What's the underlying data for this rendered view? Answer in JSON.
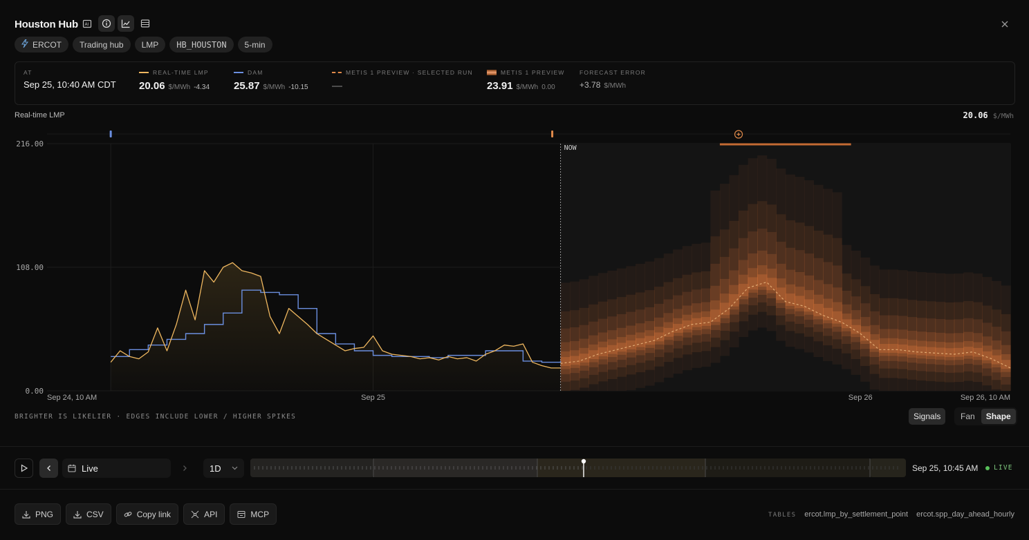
{
  "header": {
    "title": "Houston Hub",
    "icons": [
      "ai-icon",
      "info-icon",
      "chart-icon",
      "table-icon"
    ],
    "close_icon": "close-icon"
  },
  "tags": [
    {
      "label": "ERCOT",
      "icon": "bolt-icon"
    },
    {
      "label": "Trading hub"
    },
    {
      "label": "LMP"
    },
    {
      "label": "HB_HOUSTON"
    },
    {
      "label": "5-min"
    }
  ],
  "stats": {
    "at": {
      "label": "AT",
      "value": "Sep 25, 10:40 AM CDT"
    },
    "rt": {
      "label": "REAL-TIME LMP",
      "value": "20.06",
      "unit": "$/MWh",
      "delta": "-4.34",
      "color": "#f0b860"
    },
    "dam": {
      "label": "DAM",
      "value": "25.87",
      "unit": "$/MWh",
      "delta": "-10.15",
      "color": "#6b8fe0"
    },
    "preview_run": {
      "label": "METIS 1 PREVIEW · SELECTED RUN",
      "value": "—",
      "color": "#e08a4a"
    },
    "preview": {
      "label": "METIS 1 PREVIEW",
      "value": "23.91",
      "unit": "$/MWh",
      "delta": "0.00",
      "color": "#e08a4a"
    },
    "error": {
      "label": "FORECAST ERROR",
      "value": "+3.78",
      "unit": "$/MWh"
    }
  },
  "chart_header": {
    "label": "Real-time LMP",
    "value": "20.06",
    "unit": "$/MWh"
  },
  "chart_data": {
    "type": "line",
    "title": "",
    "ylim": [
      0,
      216
    ],
    "y_ticks": [
      "216.00",
      "108.00",
      "0.00"
    ],
    "x_ticks": [
      "Sep 24, 10 AM",
      "Sep 25",
      "Sep 26",
      "Sep 26, 10 AM"
    ],
    "now_label": "NOW",
    "series": [
      {
        "name": "Real-time LMP",
        "color": "#f0b860",
        "hours": [
          0,
          0.5,
          1,
          1.5,
          2,
          2.5,
          3,
          3.5,
          4,
          4.5,
          5,
          5.5,
          6,
          6.5,
          7,
          7.5,
          8,
          8.5,
          9,
          9.5,
          10,
          10.5,
          11,
          11.5,
          12,
          12.5,
          13,
          13.5,
          14,
          14.5,
          15,
          15.5,
          16,
          16.5,
          17,
          17.5,
          18,
          18.5,
          19,
          19.5,
          20,
          20.5,
          21,
          21.5,
          22,
          22.5,
          23,
          23.5,
          24
        ],
        "values": [
          25,
          35,
          30,
          28,
          34,
          55,
          35,
          58,
          88,
          62,
          105,
          95,
          108,
          112,
          105,
          103,
          100,
          65,
          50,
          72,
          65,
          58,
          50,
          45,
          40,
          35,
          37,
          38,
          48,
          35,
          32,
          31,
          30,
          28,
          29,
          27,
          30,
          28,
          29,
          26,
          32,
          35,
          40,
          39,
          41,
          25,
          22,
          20,
          20
        ]
      },
      {
        "name": "DAM",
        "color": "#6b8fe0",
        "hours": [
          0,
          1,
          2,
          3,
          4,
          5,
          6,
          7,
          8,
          9,
          10,
          11,
          12,
          13,
          14,
          15,
          16,
          17,
          18,
          19,
          20,
          21,
          22,
          23,
          24
        ],
        "values": [
          30,
          36,
          40,
          45,
          50,
          58,
          68,
          88,
          86,
          84,
          72,
          50,
          41,
          35,
          31,
          30,
          30,
          29,
          31,
          31,
          35,
          35,
          26,
          25,
          26
        ]
      },
      {
        "name": "Metis 1 Preview",
        "color": "#e8b27a",
        "hours": [
          24,
          25,
          26,
          27,
          28,
          29,
          30,
          31,
          32,
          33,
          34,
          35,
          36,
          37,
          38,
          39,
          40,
          41,
          42,
          43,
          44,
          45,
          46,
          47,
          48
        ],
        "values": [
          24,
          26,
          32,
          36,
          40,
          44,
          52,
          58,
          60,
          72,
          90,
          95,
          78,
          74,
          66,
          60,
          50,
          36,
          36,
          34,
          33,
          32,
          34,
          28,
          20
        ]
      }
    ]
  },
  "footnote": "BRIGHTER IS LIKELIER · EDGES INCLUDE LOWER / HIGHER SPIKES",
  "view": {
    "signals": "Signals",
    "fan": "Fan",
    "shape": "Shape"
  },
  "playback": {
    "live_label": "Live",
    "range": "1D",
    "timestamp": "Sep 25, 10:45 AM",
    "live_badge": "LIVE"
  },
  "actions": [
    {
      "label": "PNG",
      "icon": "download-icon"
    },
    {
      "label": "CSV",
      "icon": "download-icon"
    },
    {
      "label": "Copy link",
      "icon": "link-icon"
    },
    {
      "label": "API",
      "icon": "api-icon"
    },
    {
      "label": "MCP",
      "icon": "mcp-icon"
    }
  ],
  "tables": {
    "label": "TABLES",
    "items": [
      "ercot.lmp_by_settlement_point",
      "ercot.spp_day_ahead_hourly"
    ]
  }
}
